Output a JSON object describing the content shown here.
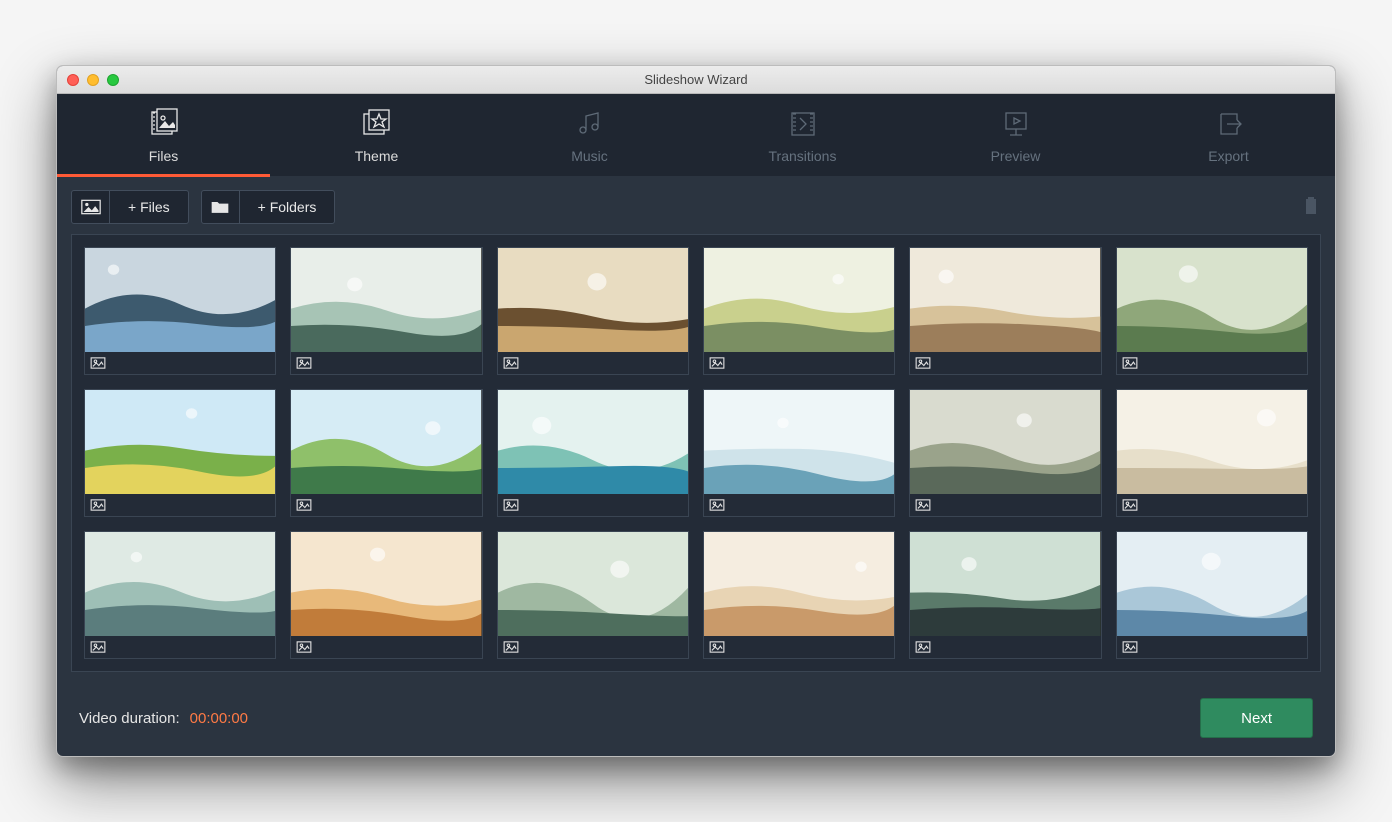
{
  "window": {
    "title": "Slideshow Wizard"
  },
  "stepper": {
    "files": {
      "label": "Files",
      "state": "active"
    },
    "theme": {
      "label": "Theme",
      "state": "enabled"
    },
    "music": {
      "label": "Music",
      "state": "disabled"
    },
    "transitions": {
      "label": "Transitions",
      "state": "disabled"
    },
    "preview": {
      "label": "Preview",
      "state": "disabled"
    },
    "export": {
      "label": "Export",
      "state": "disabled"
    }
  },
  "toolbar": {
    "add_files_label": "+ Files",
    "add_folders_label": "+ Folders",
    "trash_icon": "trash-icon"
  },
  "grid": {
    "item_count": 19,
    "visible_rows": 3,
    "columns": 6
  },
  "footer": {
    "duration_label": "Video duration:",
    "duration_value": "00:00:00",
    "next_label": "Next"
  }
}
